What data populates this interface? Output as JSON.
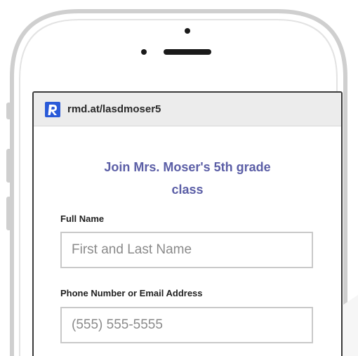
{
  "browser": {
    "url": "rmd.at/lasdmoser5",
    "logo_icon": "remind-logo-icon",
    "logo_color": "#2a5ad8"
  },
  "form": {
    "title_line1": "Join Mrs. Moser's 5th grade",
    "title_line2": "class",
    "full_name_label": "Full Name",
    "full_name_placeholder": "First and Last Name",
    "contact_label": "Phone Number or Email Address",
    "contact_placeholder": "(555) 555-5555"
  },
  "colors": {
    "title": "#5b5ea6",
    "phone_outline": "#c8c8c8"
  }
}
